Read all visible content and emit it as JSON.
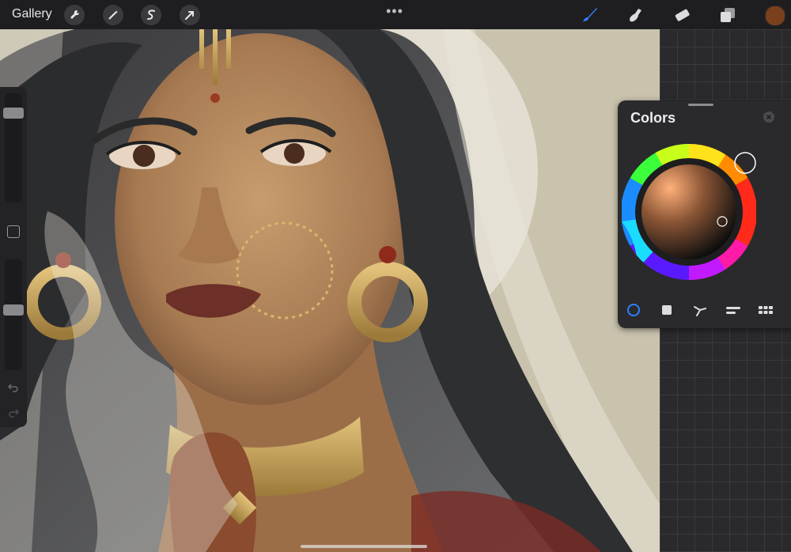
{
  "topbar": {
    "gallery_label": "Gallery",
    "left_tools": [
      "wrench-icon",
      "magic-wand-icon",
      "selection-icon",
      "transform-arrow-icon"
    ],
    "more_label": "•••",
    "right_tools": [
      "brush-icon",
      "smudge-icon",
      "eraser-icon",
      "layers-icon"
    ],
    "current_color": "#7a3f1c"
  },
  "colors_panel": {
    "title": "Colors",
    "close_icon": "close-icon",
    "selected_color": "#7a3f1c",
    "hue_color": "#ff8c2a",
    "modes": [
      "disc",
      "classic",
      "harmony",
      "value",
      "palettes"
    ],
    "active_mode": "disc"
  },
  "sidebar": {
    "brush_size_level": 0.04,
    "opacity_level": 0.45
  },
  "colors": {
    "accent": "#2f80ff",
    "panel_bg": "#2a2a2c",
    "bar_bg": "#1e1e20"
  }
}
